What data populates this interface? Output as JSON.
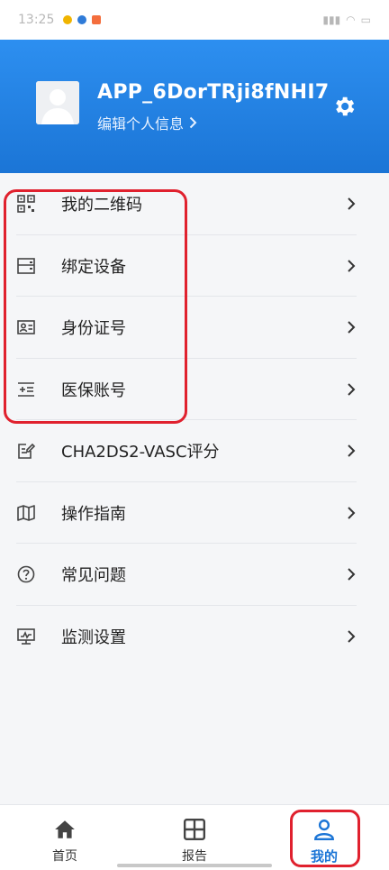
{
  "status_bar": {
    "time": "13:25"
  },
  "profile": {
    "username": "APP_6DorTRji8fNHI7",
    "edit_label": "编辑个人信息"
  },
  "menu": {
    "items": [
      {
        "label": "我的二维码",
        "icon": "qrcode-icon"
      },
      {
        "label": "绑定设备",
        "icon": "device-icon"
      },
      {
        "label": "身份证号",
        "icon": "id-card-icon"
      },
      {
        "label": "医保账号",
        "icon": "insurance-card-icon"
      },
      {
        "label": "CHA2DS2-VASC评分",
        "icon": "score-edit-icon"
      },
      {
        "label": "操作指南",
        "icon": "map-guide-icon"
      },
      {
        "label": "常见问题",
        "icon": "question-icon"
      },
      {
        "label": "监测设置",
        "icon": "monitor-icon"
      }
    ]
  },
  "bottom_nav": {
    "tabs": [
      {
        "label": "首页",
        "icon": "home-icon"
      },
      {
        "label": "报告",
        "icon": "grid-icon"
      },
      {
        "label": "我的",
        "icon": "user-icon",
        "active": true
      }
    ]
  },
  "colors": {
    "header_blue": "#1b75d6",
    "highlight_red": "#e0212e",
    "active_tab": "#1b75d6"
  }
}
